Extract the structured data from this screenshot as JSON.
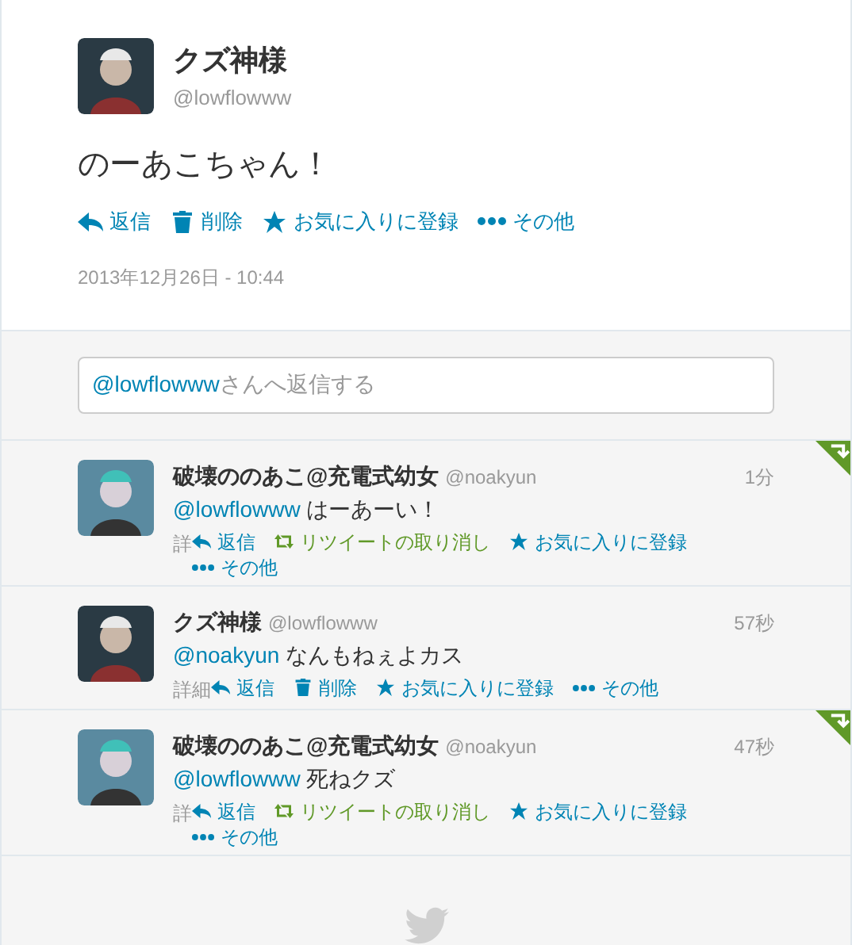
{
  "tweet": {
    "author": "クズ神様",
    "handle": "@lowflowww",
    "text": "のーあこちゃん！",
    "actions": [
      {
        "kind": "reply",
        "label": "返信"
      },
      {
        "kind": "delete",
        "label": "削除"
      },
      {
        "kind": "favorite",
        "label": "お気に入りに登録"
      },
      {
        "kind": "more",
        "label": "その他"
      }
    ],
    "timestamp": "2013年12月26日 - 10:44"
  },
  "reply_box": {
    "placeholder_mention": "@lowflowww",
    "placeholder": "さんへ返信する"
  },
  "replies": [
    {
      "author": "破壊ののあこ@充電式幼女",
      "handle": "@noakyun",
      "time": "1分",
      "mention": "@lowflowww",
      "text": "はーあーい！",
      "retweeted": true,
      "detail": "詳",
      "actions": [
        {
          "kind": "reply",
          "label": "返信"
        },
        {
          "kind": "retweet_undo",
          "label": "リツイートの取り消し"
        },
        {
          "kind": "favorite",
          "label": "お気に入りに登録"
        },
        {
          "kind": "more",
          "label": "その他"
        }
      ]
    },
    {
      "author": "クズ神様",
      "handle": "@lowflowww",
      "time": "57秒",
      "mention": "@noakyun",
      "text": "なんもねぇよカス",
      "retweeted": false,
      "detail": "詳細",
      "actions": [
        {
          "kind": "reply",
          "label": "返信"
        },
        {
          "kind": "delete",
          "label": "削除"
        },
        {
          "kind": "favorite",
          "label": "お気に入りに登録"
        },
        {
          "kind": "more",
          "label": "その他"
        }
      ]
    },
    {
      "author": "破壊ののあこ@充電式幼女",
      "handle": "@noakyun",
      "time": "47秒",
      "mention": "@lowflowww",
      "text": "死ねクズ",
      "retweeted": true,
      "detail": "詳",
      "actions": [
        {
          "kind": "reply",
          "label": "返信"
        },
        {
          "kind": "retweet_undo",
          "label": "リツイートの取り消し"
        },
        {
          "kind": "favorite",
          "label": "お気に入りに登録"
        },
        {
          "kind": "more",
          "label": "その他"
        }
      ]
    }
  ]
}
